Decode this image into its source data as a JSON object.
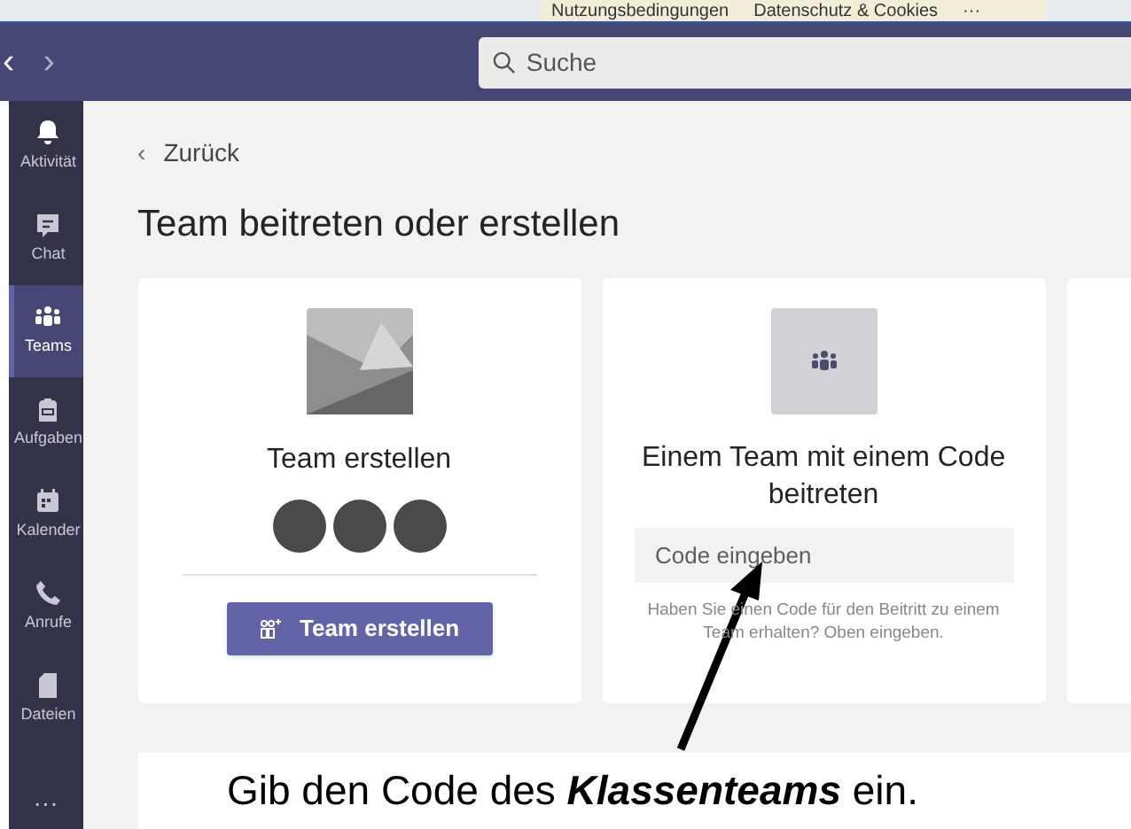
{
  "top_links": [
    "Nutzungsbedingungen",
    "Datenschutz & Cookies",
    "···"
  ],
  "header": {
    "back_arrow": "‹",
    "forward_arrow": "›",
    "search": {
      "placeholder": "Suche"
    }
  },
  "sidebar": {
    "items": [
      {
        "label": "Aktivität",
        "kind": "bell",
        "selected": false
      },
      {
        "label": "Chat",
        "kind": "chat",
        "selected": false
      },
      {
        "label": "Teams",
        "kind": "teams",
        "selected": true
      },
      {
        "label": "Aufgaben",
        "kind": "bag",
        "selected": false
      },
      {
        "label": "Kalender",
        "kind": "calendar",
        "selected": false
      },
      {
        "label": "Anrufe",
        "kind": "phone",
        "selected": false
      },
      {
        "label": "Dateien",
        "kind": "file",
        "selected": false
      }
    ],
    "more": "···"
  },
  "back_link": {
    "arrow": "‹",
    "label": "Zurück"
  },
  "page_title": "Team beitreten oder erstellen",
  "cards": [
    {
      "kind": "create",
      "title": "Team erstellen",
      "button": "Team erstellen"
    },
    {
      "kind": "join",
      "title": "Einem Team mit einem Code beitreten",
      "code_field": {
        "placeholder": "Code eingeben"
      },
      "hint": "Haben Sie einen Code für den Beitritt zu einem Team erhalten? Oben eingeben."
    }
  ],
  "annotation": "Gib den Code des **Klassenteams** ein."
}
